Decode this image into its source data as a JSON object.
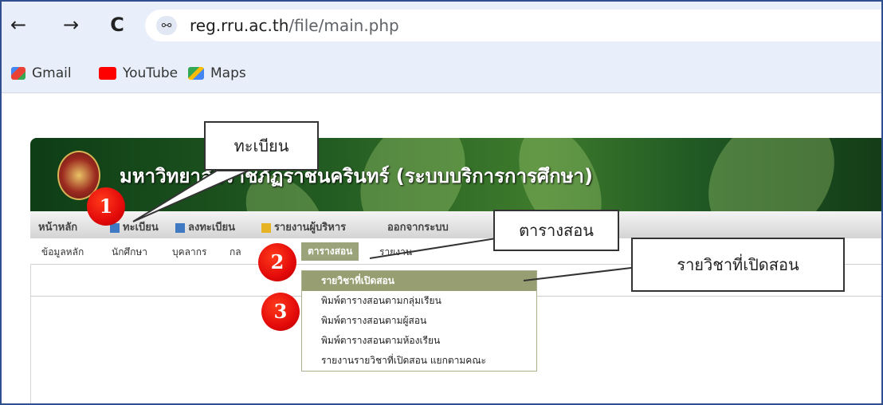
{
  "browser": {
    "back_icon": "←",
    "forward_icon": "→",
    "reload_icon": "C",
    "site_info_icon": "⚯",
    "url_host": "reg.rru.ac.th",
    "url_path": "/file/main.php"
  },
  "bookmarks": [
    {
      "label": "Gmail",
      "icon": "gmail-icon",
      "color": "#d93025"
    },
    {
      "label": "YouTube",
      "icon": "youtube-icon",
      "color": "#ff0000"
    },
    {
      "label": "Maps",
      "icon": "maps-icon",
      "color": "#34a853"
    }
  ],
  "banner": {
    "title": "มหาวิทยาลัยราชภัฏราชนครินทร์ (ระบบบริการการศึกษา)"
  },
  "menu_main": [
    "หน้าหลัก",
    "ทะเบียน",
    "ลงทะเบียน",
    "รายงานผู้บริหาร",
    "ออกจากระบบ"
  ],
  "menu_sub": [
    "ข้อมูลหลัก",
    "นักศึกษา",
    "บุคลากร",
    "กล",
    "ตารางสอน",
    "รายงาน"
  ],
  "dropdown": [
    "รายวิชาที่เปิดสอน",
    "พิมพ์ตารางสอนตามกลุ่มเรียน",
    "พิมพ์ตารางสอนตามผู้สอน",
    "พิมพ์ตารางสอนตามห้องเรียน",
    "รายงานรายวิชาที่เปิดสอน แยกตามคณะ"
  ],
  "callouts": {
    "register": "ทะเบียน",
    "timetable": "ตารางสอน",
    "courses": "รายวิชาที่เปิดสอน"
  },
  "steps": [
    "1",
    "2",
    "3"
  ],
  "colors": {
    "accent_red": "#e30a0a",
    "menu_highlight": "#969e72",
    "banner_green": "#235c22"
  }
}
